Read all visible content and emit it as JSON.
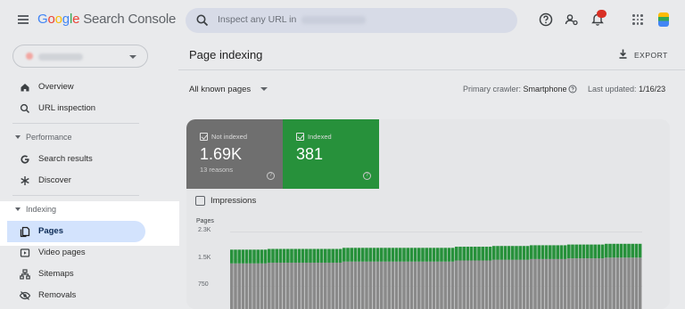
{
  "header": {
    "logo_letters": [
      "G",
      "o",
      "o",
      "g",
      "l",
      "e"
    ],
    "logo_rest": " Search Console",
    "search_placeholder": "Inspect any URL in"
  },
  "sidebar": {
    "items": [
      {
        "label": "Overview",
        "icon": "home-icon"
      },
      {
        "label": "URL inspection",
        "icon": "search-icon"
      }
    ],
    "performance_section": "Performance",
    "performance_items": [
      {
        "label": "Search results",
        "icon": "google-g-icon"
      },
      {
        "label": "Discover",
        "icon": "asterisk-icon"
      }
    ],
    "indexing_section": "Indexing",
    "indexing_items": [
      {
        "label": "Pages",
        "icon": "pages-icon"
      },
      {
        "label": "Video pages",
        "icon": "video-pages-icon"
      },
      {
        "label": "Sitemaps",
        "icon": "sitemaps-icon"
      },
      {
        "label": "Removals",
        "icon": "removals-icon"
      }
    ]
  },
  "main": {
    "title": "Page indexing",
    "export_label": "EXPORT",
    "filter_label": "All known pages",
    "crawler_label": "Primary crawler:",
    "crawler_value": "Smartphone",
    "updated_label": "Last updated:",
    "updated_value": "1/16/23"
  },
  "summary": {
    "not_indexed": {
      "label": "Not indexed",
      "value": "1.69K",
      "sub": "13 reasons",
      "color": "#6f6f6f"
    },
    "indexed": {
      "label": "Indexed",
      "value": "381",
      "color": "#27913b"
    }
  },
  "impressions_label": "Impressions",
  "chart_data": {
    "type": "bar",
    "stacked": true,
    "ylabel": "Pages",
    "yticks": [
      "2.3K",
      "1.5K",
      "750"
    ],
    "ylim": [
      0,
      2300
    ],
    "series": [
      {
        "name": "Not indexed",
        "color": "#8a8a8a",
        "values": [
          1420,
          1420,
          1420,
          1420,
          1420,
          1420,
          1420,
          1420,
          1420,
          1420,
          1440,
          1440,
          1440,
          1440,
          1440,
          1440,
          1440,
          1440,
          1440,
          1440,
          1440,
          1440,
          1440,
          1440,
          1440,
          1440,
          1440,
          1440,
          1440,
          1440,
          1470,
          1470,
          1470,
          1470,
          1470,
          1470,
          1470,
          1470,
          1470,
          1470,
          1470,
          1470,
          1470,
          1470,
          1470,
          1470,
          1470,
          1470,
          1470,
          1470,
          1470,
          1470,
          1470,
          1470,
          1470,
          1470,
          1470,
          1470,
          1470,
          1470,
          1500,
          1500,
          1500,
          1500,
          1500,
          1500,
          1500,
          1500,
          1500,
          1500,
          1520,
          1520,
          1520,
          1520,
          1520,
          1520,
          1520,
          1520,
          1520,
          1520,
          1540,
          1540,
          1540,
          1540,
          1540,
          1540,
          1540,
          1540,
          1540,
          1540,
          1560,
          1560,
          1560,
          1560,
          1560,
          1560,
          1560,
          1560,
          1560,
          1560,
          1580,
          1580,
          1580,
          1580,
          1580,
          1580,
          1580,
          1580,
          1580,
          1580
        ]
      },
      {
        "name": "Indexed",
        "color": "#27913b",
        "values": [
          380,
          380,
          380,
          380,
          380,
          380,
          380,
          380,
          380,
          380,
          380,
          380,
          380,
          380,
          380,
          380,
          380,
          380,
          380,
          380,
          380,
          380,
          380,
          380,
          380,
          380,
          380,
          380,
          380,
          380,
          380,
          380,
          380,
          380,
          380,
          380,
          380,
          380,
          380,
          380,
          380,
          380,
          380,
          380,
          380,
          380,
          380,
          380,
          380,
          380,
          380,
          380,
          380,
          380,
          380,
          380,
          380,
          380,
          380,
          380,
          381,
          381,
          381,
          381,
          381,
          381,
          381,
          381,
          381,
          381,
          381,
          381,
          381,
          381,
          381,
          381,
          381,
          381,
          381,
          381,
          381,
          381,
          381,
          381,
          381,
          381,
          381,
          381,
          381,
          381,
          381,
          381,
          381,
          381,
          381,
          381,
          381,
          381,
          381,
          381,
          381,
          381,
          381,
          381,
          381,
          381,
          381,
          381,
          381,
          381
        ]
      }
    ]
  }
}
